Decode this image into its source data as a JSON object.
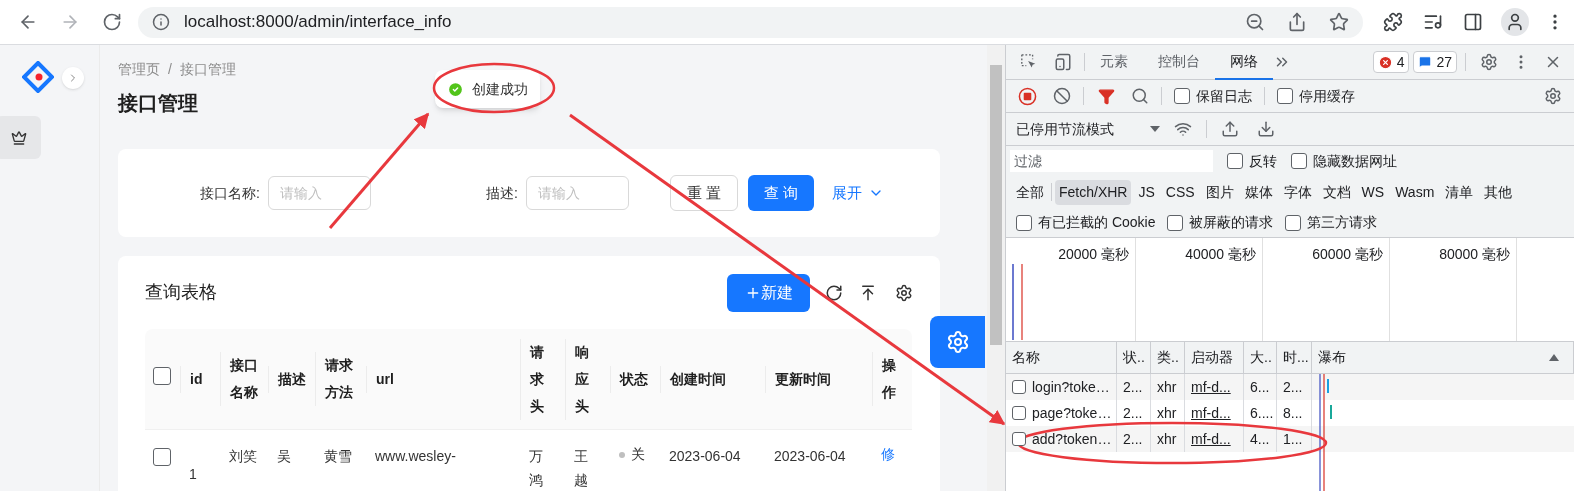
{
  "browser": {
    "url": "localhost:8000/admin/interface_info"
  },
  "page": {
    "breadcrumb": [
      "管理页",
      "接口管理"
    ],
    "breadcrumb_separator": "/",
    "title": "接口管理",
    "toast": "创建成功",
    "search_form": {
      "fields": [
        {
          "label": "接口名称:",
          "placeholder": "请输入"
        },
        {
          "label": "描述:",
          "placeholder": "请输入"
        }
      ],
      "buttons": [
        {
          "label": "重 置",
          "kind": "default"
        },
        {
          "label": "查 询",
          "kind": "primary"
        }
      ],
      "expand_link": "展开"
    },
    "table_card": {
      "title": "查询表格",
      "new_button": "新建",
      "all_selected": false,
      "columns": [
        "id",
        "接口名称",
        "描述",
        "请求方法",
        "url",
        "请求头",
        "响应头",
        "状态",
        "创建时间",
        "更新时间",
        "操作"
      ],
      "rows": [
        {
          "selected": false,
          "cells": [
            "1",
            "刘笑",
            "吴",
            "黄雪",
            "www.wesley-",
            "万鸿",
            "王越",
            "关",
            "2023-06-04",
            "2023-06-04",
            "修"
          ]
        }
      ]
    }
  },
  "devtools": {
    "tabs": [
      {
        "label": "元素",
        "selected": false
      },
      {
        "label": "控制台",
        "selected": false
      },
      {
        "label": "网络",
        "selected": true
      }
    ],
    "errors": "4",
    "messages": "27",
    "options": [
      {
        "label": "保留日志",
        "checked": false
      },
      {
        "label": "停用缓存",
        "checked": false
      }
    ],
    "throttling": "已停用节流模式",
    "filter": {
      "placeholder": "过滤"
    },
    "filter_options": [
      {
        "label": "反转",
        "checked": false
      },
      {
        "label": "隐藏数据网址",
        "checked": false
      }
    ],
    "types": [
      {
        "label": "全部",
        "selected": false
      },
      {
        "label": "Fetch/XHR",
        "selected": true
      },
      {
        "label": "JS",
        "selected": false
      },
      {
        "label": "CSS",
        "selected": false
      },
      {
        "label": "图片",
        "selected": false
      },
      {
        "label": "媒体",
        "selected": false
      },
      {
        "label": "字体",
        "selected": false
      },
      {
        "label": "文档",
        "selected": false
      },
      {
        "label": "WS",
        "selected": false
      },
      {
        "label": "Wasm",
        "selected": false
      },
      {
        "label": "清单",
        "selected": false
      },
      {
        "label": "其他",
        "selected": false
      }
    ],
    "request_options": [
      {
        "label": "有已拦截的 Cookie",
        "checked": false
      },
      {
        "label": "被屏蔽的请求",
        "checked": false
      },
      {
        "label": "第三方请求",
        "checked": false
      }
    ],
    "timeline_ticks": [
      "20000 毫秒",
      "40000 毫秒",
      "60000 毫秒",
      "80000 毫秒"
    ],
    "columns": [
      "名称",
      "状..",
      "类..",
      "启动器",
      "大..",
      "时...",
      "瀑布"
    ],
    "requests": [
      {
        "checked": false,
        "cells": [
          "login?toke…",
          "2...",
          "xhr",
          "mf-d...",
          "6...",
          "2..."
        ]
      },
      {
        "checked": false,
        "cells": [
          "page?toke…",
          "2...",
          "xhr",
          "mf-d...",
          "6....",
          "8..."
        ]
      },
      {
        "checked": false,
        "cells": [
          "add?token…",
          "2...",
          "xhr",
          "mf-d...",
          "4...",
          "1..."
        ]
      }
    ]
  }
}
